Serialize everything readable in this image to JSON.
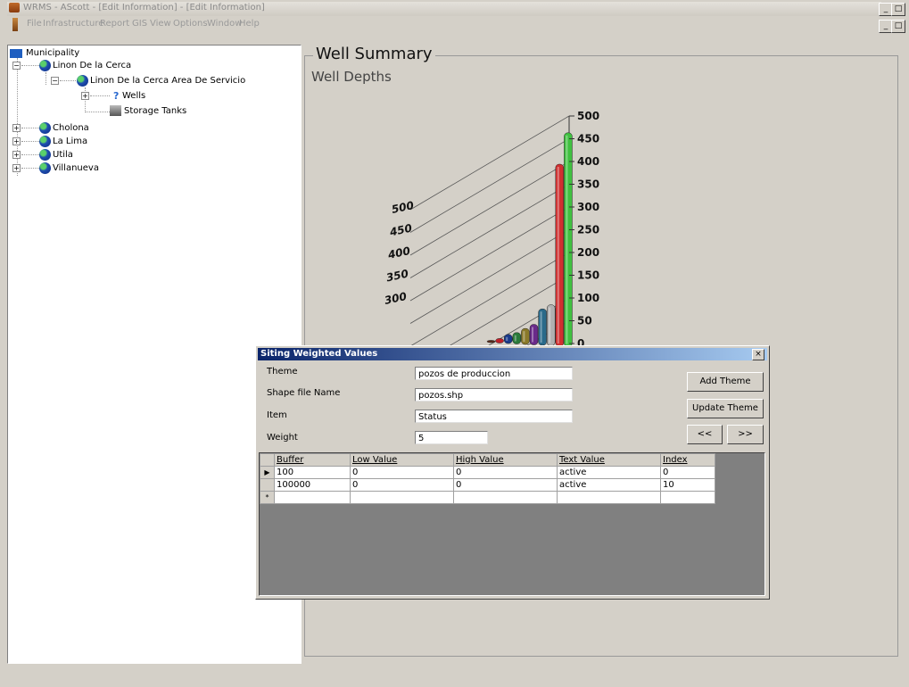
{
  "window": {
    "title": "WRMS - AScott - [Edit Information] - [Edit Information]",
    "controls": [
      "_",
      "□",
      "×"
    ]
  },
  "menu": [
    "File",
    "Infrastructure",
    "Report",
    "GIS",
    "View",
    "Options",
    "Window",
    "Help"
  ],
  "tree": {
    "root": "Municipality",
    "items": [
      {
        "label": "Linon De la Cerca",
        "children": [
          {
            "label": "Linon De la Cerca Area De Servicio",
            "children": [
              {
                "label": "Wells"
              },
              {
                "label": "Storage Tanks"
              }
            ]
          }
        ]
      },
      {
        "label": "Cholona"
      },
      {
        "label": "La Lima"
      },
      {
        "label": "Utila"
      },
      {
        "label": "Villanueva"
      }
    ]
  },
  "summary": {
    "title": "Well Summary",
    "subtitle": "Well Depths"
  },
  "chart_data": {
    "type": "bar",
    "title": "Well Depths",
    "right_axis_ticks": [
      "500",
      "450",
      "400",
      "350",
      "300",
      "250",
      "200",
      "150",
      "100",
      "50",
      "0"
    ],
    "left_axis_ticks": [
      "500",
      "450",
      "400",
      "350",
      "300"
    ],
    "ylim": [
      0,
      500
    ],
    "series": [
      {
        "color": "#5a2a1a",
        "values": [
          5
        ]
      },
      {
        "color": "#c0202a",
        "values": [
          10
        ]
      },
      {
        "color": "#1a3a8a",
        "values": [
          20
        ]
      },
      {
        "color": "#2a7a3a",
        "values": [
          25
        ]
      },
      {
        "color": "#8a7a2a",
        "values": [
          35
        ]
      },
      {
        "color": "#6a2a8a",
        "values": [
          45
        ]
      },
      {
        "color": "#2a6a8a",
        "values": [
          80
        ]
      },
      {
        "color": "#b0b0b0",
        "values": [
          90
        ]
      },
      {
        "color": "#d03030",
        "values": [
          400
        ]
      },
      {
        "color": "#40c040",
        "values": [
          470
        ]
      }
    ]
  },
  "dialog": {
    "title": "Siting Weighted Values",
    "fields": {
      "theme_label": "Theme",
      "theme_value": "pozos de produccion",
      "shape_label": "Shape file Name",
      "shape_value": "pozos.shp",
      "item_label": "Item",
      "item_value": "Status",
      "weight_label": "Weight",
      "weight_value": "5"
    },
    "buttons": {
      "add_theme": "Add Theme",
      "update_theme": "Update Theme",
      "prev": "<<",
      "next": ">>"
    },
    "grid": {
      "columns": [
        "Buffer",
        "Low Value",
        "High Value",
        "Text Value",
        "Index"
      ],
      "rows": [
        {
          "marker": "▶",
          "cells": [
            "100",
            "0",
            "0",
            "active",
            "0"
          ]
        },
        {
          "marker": "",
          "cells": [
            "100000",
            "0",
            "0",
            "active",
            "10"
          ]
        },
        {
          "marker": "*",
          "cells": [
            "",
            "",
            "",
            "",
            ""
          ]
        }
      ]
    }
  }
}
